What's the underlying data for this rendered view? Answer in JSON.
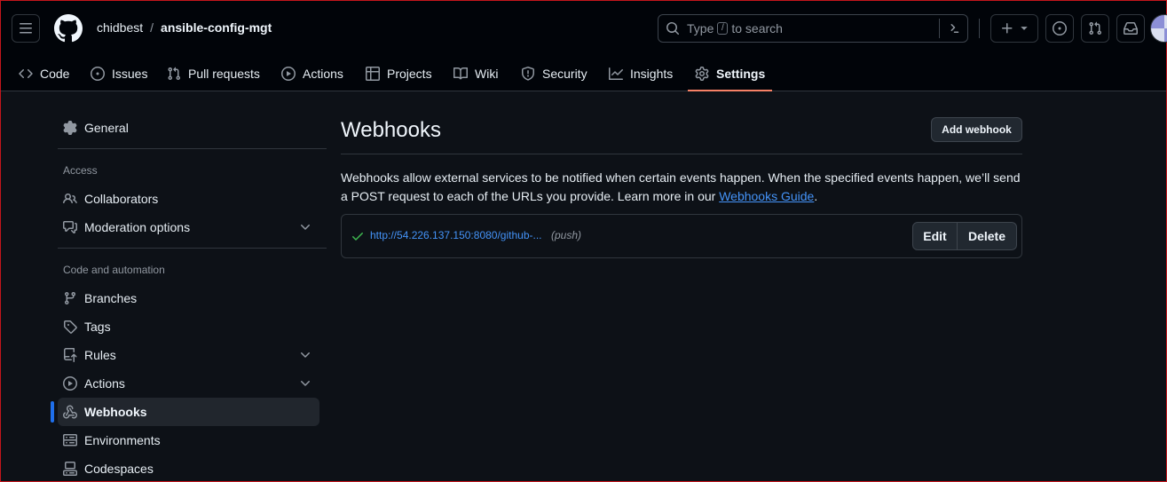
{
  "header": {
    "owner": "chidbest",
    "separator": "/",
    "repo": "ansible-config-mgt",
    "search": {
      "placeholder_prefix": "Type",
      "placeholder_key": "/",
      "placeholder_suffix": "to search"
    }
  },
  "tabs": [
    {
      "label": "Code",
      "icon": "code-icon"
    },
    {
      "label": "Issues",
      "icon": "issue-icon"
    },
    {
      "label": "Pull requests",
      "icon": "pull-request-icon"
    },
    {
      "label": "Actions",
      "icon": "play-icon"
    },
    {
      "label": "Projects",
      "icon": "table-icon"
    },
    {
      "label": "Wiki",
      "icon": "book-icon"
    },
    {
      "label": "Security",
      "icon": "shield-icon"
    },
    {
      "label": "Insights",
      "icon": "graph-icon"
    },
    {
      "label": "Settings",
      "icon": "gear-icon",
      "active": true
    }
  ],
  "sidebar": {
    "general": "General",
    "access_heading": "Access",
    "collaborators": "Collaborators",
    "moderation": "Moderation options",
    "code_heading": "Code and automation",
    "branches": "Branches",
    "tags": "Tags",
    "rules": "Rules",
    "actions": "Actions",
    "webhooks": "Webhooks",
    "environments": "Environments",
    "codespaces": "Codespaces"
  },
  "main": {
    "title": "Webhooks",
    "add_button": "Add webhook",
    "description": "Webhooks allow external services to be notified when certain events happen. When the specified events happen, we’ll send a POST request to each of the URLs you provide. Learn more in our ",
    "guide_link": "Webhooks Guide",
    "description_end": ".",
    "hook": {
      "url": "http://54.226.137.150:8080/github-...",
      "events": "(push)",
      "edit": "Edit",
      "delete": "Delete"
    }
  },
  "colors": {
    "accent_underline": "#f78166",
    "active_bar": "#1f6feb",
    "link": "#4493f8",
    "success": "#3fb950"
  }
}
